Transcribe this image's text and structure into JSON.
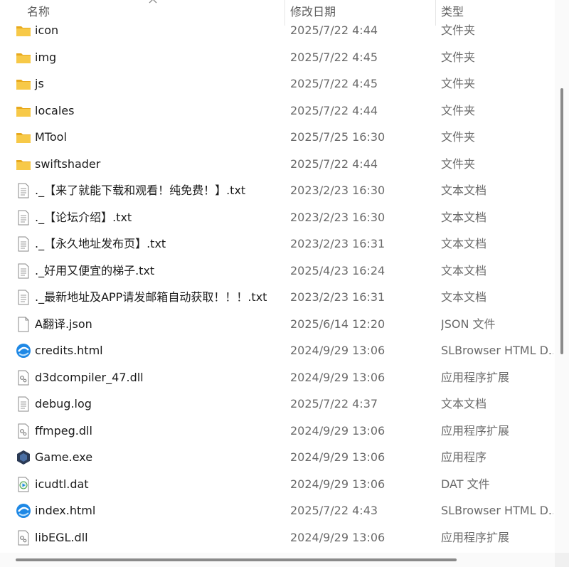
{
  "columns": {
    "name": "名称",
    "date": "修改日期",
    "type": "类型"
  },
  "files": [
    {
      "name": "icon",
      "date": "2025/7/22 4:44",
      "type": "文件夹",
      "icon": "folder-icon"
    },
    {
      "name": "img",
      "date": "2025/7/22 4:45",
      "type": "文件夹",
      "icon": "folder-icon"
    },
    {
      "name": "js",
      "date": "2025/7/22 4:45",
      "type": "文件夹",
      "icon": "folder-icon"
    },
    {
      "name": "locales",
      "date": "2025/7/22 4:44",
      "type": "文件夹",
      "icon": "folder-icon"
    },
    {
      "name": "MTool",
      "date": "2025/7/25 16:30",
      "type": "文件夹",
      "icon": "folder-icon"
    },
    {
      "name": "swiftshader",
      "date": "2025/7/22 4:44",
      "type": "文件夹",
      "icon": "folder-icon"
    },
    {
      "name": "._【来了就能下载和观看！纯免费！】.txt",
      "date": "2023/2/23 16:30",
      "type": "文本文档",
      "icon": "text-file-icon"
    },
    {
      "name": "._【论坛介绍】.txt",
      "date": "2023/2/23 16:30",
      "type": "文本文档",
      "icon": "text-file-icon"
    },
    {
      "name": "._【永久地址发布页】.txt",
      "date": "2023/2/23 16:31",
      "type": "文本文档",
      "icon": "text-file-icon"
    },
    {
      "name": "._好用又便宜的梯子.txt",
      "date": "2025/4/23 16:24",
      "type": "文本文档",
      "icon": "text-file-icon"
    },
    {
      "name": "._最新地址及APP请发邮箱自动获取！！！.txt",
      "date": "2023/2/23 16:31",
      "type": "文本文档",
      "icon": "text-file-icon"
    },
    {
      "name": "A翻译.json",
      "date": "2025/6/14 12:20",
      "type": "JSON 文件",
      "icon": "blank-file-icon"
    },
    {
      "name": "credits.html",
      "date": "2024/9/29 13:06",
      "type": "SLBrowser HTML D...",
      "icon": "browser-icon"
    },
    {
      "name": "d3dcompiler_47.dll",
      "date": "2024/9/29 13:06",
      "type": "应用程序扩展",
      "icon": "dll-file-icon"
    },
    {
      "name": "debug.log",
      "date": "2025/7/22 4:37",
      "type": "文本文档",
      "icon": "text-file-icon"
    },
    {
      "name": "ffmpeg.dll",
      "date": "2024/9/29 13:06",
      "type": "应用程序扩展",
      "icon": "dll-file-icon"
    },
    {
      "name": "Game.exe",
      "date": "2024/9/29 13:06",
      "type": "应用程序",
      "icon": "game-exe-icon"
    },
    {
      "name": "icudtl.dat",
      "date": "2024/9/29 13:06",
      "type": "DAT 文件",
      "icon": "media-file-icon"
    },
    {
      "name": "index.html",
      "date": "2025/7/22 4:43",
      "type": "SLBrowser HTML D...",
      "icon": "browser-icon"
    },
    {
      "name": "libEGL.dll",
      "date": "2024/9/29 13:06",
      "type": "应用程序扩展",
      "icon": "dll-file-icon"
    }
  ],
  "colors": {
    "folder": "#f7c948",
    "folder_tab": "#e8a91d",
    "browser": "#1e88e5",
    "exe": "#2b3a55"
  }
}
